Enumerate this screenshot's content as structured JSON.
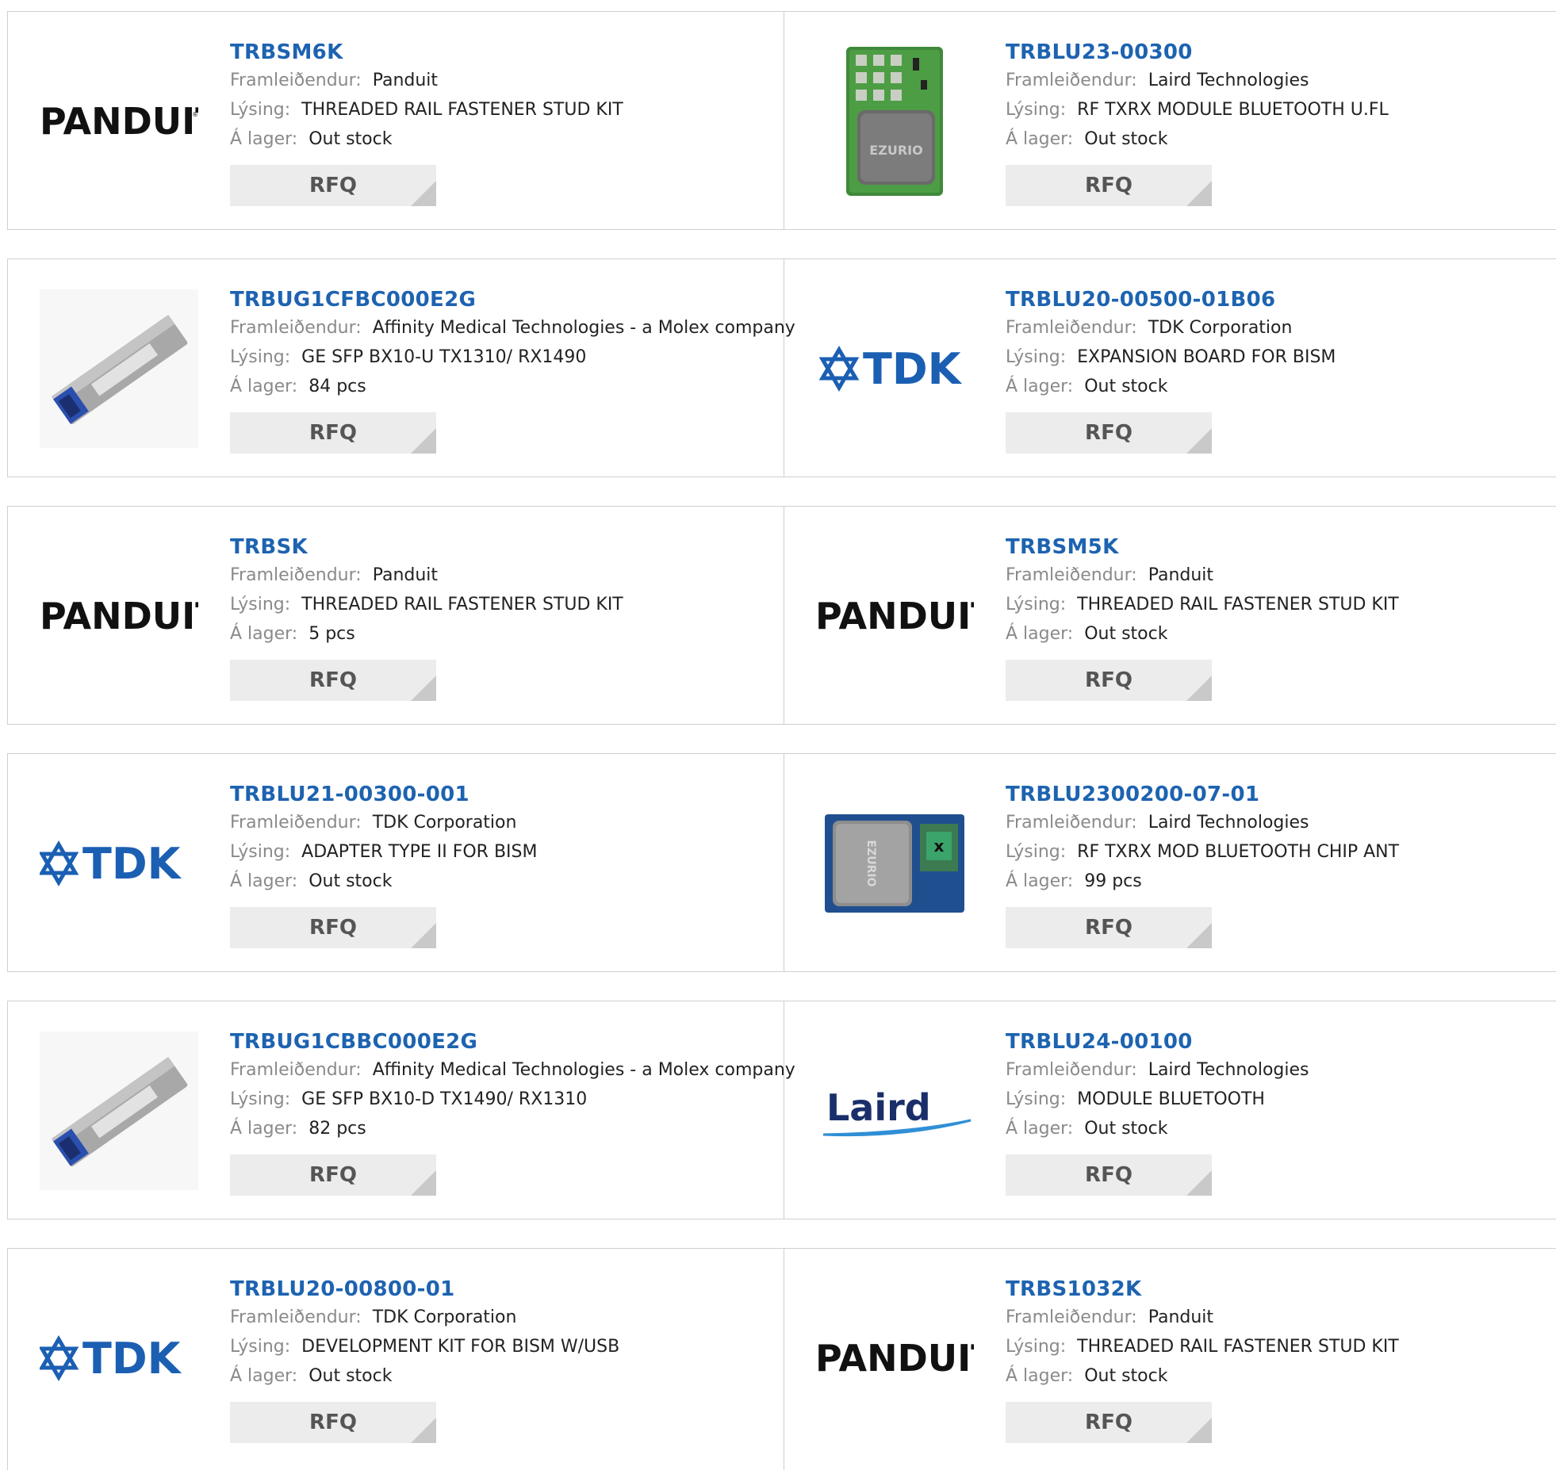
{
  "labels": {
    "manufacturer": "Framleiðendur:",
    "description": "Lýsing:",
    "stock": "Á lager:",
    "rfq": "RFQ"
  },
  "colors": {
    "link": "#1d63b0",
    "tdk": "#1b5fb3",
    "laird_swoosh": "#2f8fd6"
  },
  "products": [
    {
      "part": "TRBSM6K",
      "manufacturer": "Panduit",
      "description": "THREADED RAIL FASTENER STUD KIT",
      "stock": "Out stock",
      "logo": "panduit-logo",
      "logo_text": "PANDUIT"
    },
    {
      "part": "TRBLU23-00300",
      "manufacturer": "Laird Technologies",
      "description": "RF TXRX MODULE BLUETOOTH U.FL",
      "stock": "Out stock",
      "logo": "ezurio-module-image",
      "logo_text": "EZURIO"
    },
    {
      "part": "TRBUG1CFBC000E2G",
      "manufacturer": "Affinity Medical Technologies - a Molex company",
      "description": "GE SFP BX10-U TX1310/ RX1490",
      "stock": "84 pcs",
      "logo": "sfp-transceiver-image",
      "logo_text": ""
    },
    {
      "part": "TRBLU20-00500-01B06",
      "manufacturer": "TDK Corporation",
      "description": "EXPANSION BOARD FOR BISM",
      "stock": "Out stock",
      "logo": "tdk-logo",
      "logo_text": "TDK"
    },
    {
      "part": "TRBSK",
      "manufacturer": "Panduit",
      "description": "THREADED RAIL FASTENER STUD KIT",
      "stock": "5 pcs",
      "logo": "panduit-logo",
      "logo_text": "PANDUIT"
    },
    {
      "part": "TRBSM5K",
      "manufacturer": "Panduit",
      "description": "THREADED RAIL FASTENER STUD KIT",
      "stock": "Out stock",
      "logo": "panduit-logo",
      "logo_text": "PANDUIT"
    },
    {
      "part": "TRBLU21-00300-001",
      "manufacturer": "TDK Corporation",
      "description": "ADAPTER TYPE II FOR BISM",
      "stock": "Out stock",
      "logo": "tdk-logo",
      "logo_text": "TDK"
    },
    {
      "part": "TRBLU2300200-07-01",
      "manufacturer": "Laird Technologies",
      "description": "RF TXRX MOD BLUETOOTH CHIP ANT",
      "stock": "99 pcs",
      "logo": "ezurio-chip-image",
      "logo_text": "EZURIO"
    },
    {
      "part": "TRBUG1CBBC000E2G",
      "manufacturer": "Affinity Medical Technologies - a Molex company",
      "description": "GE SFP BX10-D TX1490/ RX1310",
      "stock": "82 pcs",
      "logo": "sfp-transceiver-image",
      "logo_text": ""
    },
    {
      "part": "TRBLU24-00100",
      "manufacturer": "Laird Technologies",
      "description": "MODULE BLUETOOTH",
      "stock": "Out stock",
      "logo": "laird-logo",
      "logo_text": "Laird"
    },
    {
      "part": "TRBLU20-00800-01",
      "manufacturer": "TDK Corporation",
      "description": "DEVELOPMENT KIT FOR BISM W/USB",
      "stock": "Out stock",
      "logo": "tdk-logo",
      "logo_text": "TDK"
    },
    {
      "part": "TRBS1032K",
      "manufacturer": "Panduit",
      "description": "THREADED RAIL FASTENER STUD KIT",
      "stock": "Out stock",
      "logo": "panduit-logo",
      "logo_text": "PANDUIT"
    }
  ]
}
